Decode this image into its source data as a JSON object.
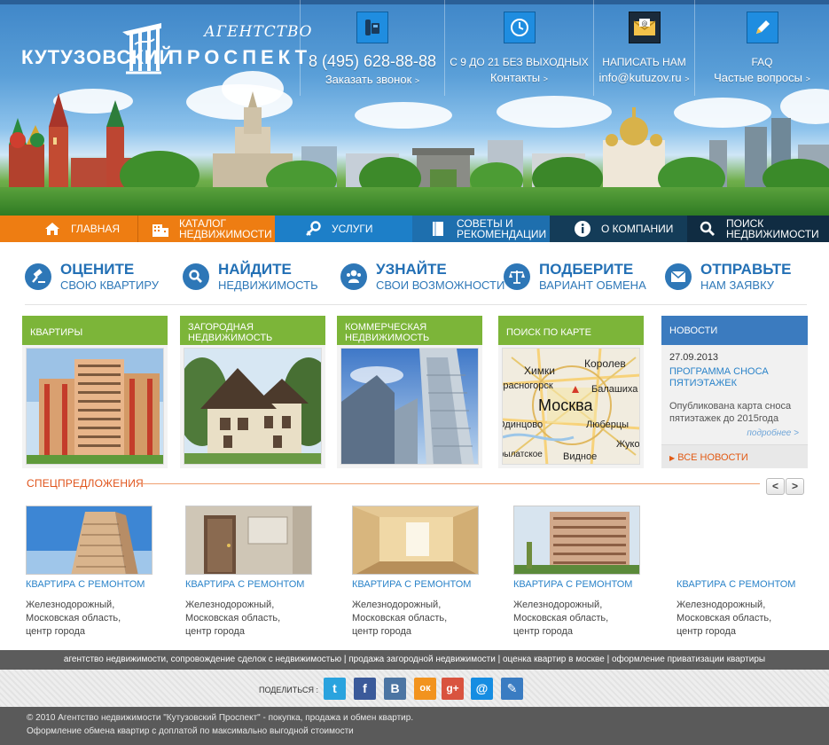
{
  "header": {
    "agency_label": "АГЕНТСТВО",
    "name_part1": "КУТУЗОВСКИЙ",
    "name_part2": "ПРОСПЕКТ",
    "contacts": [
      {
        "icon": "phone-icon",
        "line1": "8 (495) 628-88-88",
        "line2": "Заказать звонок",
        "arrow": ">"
      },
      {
        "icon": "clock-icon",
        "line1": "С 9 ДО 21 БЕЗ ВЫХОДНЫХ",
        "line2": "Контакты",
        "arrow": ">"
      },
      {
        "icon": "mail-icon",
        "line1": "НАПИСАТЬ НАМ",
        "line2": "info@kutuzov.ru",
        "arrow": ">"
      },
      {
        "icon": "pencil-icon",
        "line1": "FAQ",
        "line2": "Частые вопросы",
        "arrow": ">"
      }
    ]
  },
  "nav": [
    {
      "icon": "home-icon",
      "label": "ГЛАВНАЯ"
    },
    {
      "icon": "building-icon",
      "label": "КАТАЛОГ НЕДВИЖИМОСТИ"
    },
    {
      "icon": "key-icon",
      "label": "УСЛУГИ"
    },
    {
      "icon": "book-icon",
      "label": "СОВЕТЫ И РЕКОМЕНДАЦИИ"
    },
    {
      "icon": "info-icon",
      "label": "О КОМПАНИИ"
    },
    {
      "icon": "search-icon",
      "label": "ПОИСК НЕДВИЖИМОСТИ"
    }
  ],
  "actions": [
    {
      "icon": "gavel-icon",
      "title": "ОЦЕНИТЕ",
      "subtitle": "СВОЮ КВАРТИРУ"
    },
    {
      "icon": "search-icon",
      "title": "НАЙДИТЕ",
      "subtitle": "НЕДВИЖИМОСТЬ"
    },
    {
      "icon": "people-icon",
      "title": "УЗНАЙТЕ",
      "subtitle": "СВОИ ВОЗМОЖНОСТИ"
    },
    {
      "icon": "scales-icon",
      "title": "ПОДБЕРИТЕ",
      "subtitle": "ВАРИАНТ ОБМЕНА"
    },
    {
      "icon": "envelope-icon",
      "title": "ОТПРАВЬТЕ",
      "subtitle": "НАМ ЗАЯВКУ"
    }
  ],
  "categories": [
    {
      "label": "КВАРТИРЫ"
    },
    {
      "label": "ЗАГОРОДНАЯ НЕДВИЖИМОСТЬ"
    },
    {
      "label": "КОММЕРЧЕСКАЯ НЕДВИЖИМОСТЬ"
    },
    {
      "label": "ПОИСК ПО КАРТЕ"
    }
  ],
  "map_labels": {
    "city": "Москва",
    "places": [
      "Химки",
      "Королев",
      "Красногорск",
      "Балашиха",
      "Одинцово",
      "Люберцы",
      "Видное",
      "Жуковский",
      "Крылатское"
    ]
  },
  "news": {
    "header": "НОВОСТИ",
    "date": "27.09.2013",
    "title": "ПРОГРАММА СНОСА ПЯТИЭТАЖЕК",
    "text": "Опубликована карта сноса пятиэтажек до 2015года",
    "more": "подробнее >",
    "all": "ВСЕ НОВОСТИ"
  },
  "specials": {
    "title": "СПЕЦПРЕДЛОЖЕНИЯ",
    "prev": "<",
    "next": ">",
    "items": [
      {
        "title": "КВАРТИРА С РЕМОНТОМ",
        "line1": "Железнодорожный,",
        "line2": "Московская область,",
        "line3": "центр города"
      },
      {
        "title": "КВАРТИРА С РЕМОНТОМ",
        "line1": "Железнодорожный,",
        "line2": "Московская область,",
        "line3": "центр города"
      },
      {
        "title": "КВАРТИРА С РЕМОНТОМ",
        "line1": "Железнодорожный,",
        "line2": "Московская область,",
        "line3": "центр города"
      },
      {
        "title": "КВАРТИРА С РЕМОНТОМ",
        "line1": "Железнодорожный,",
        "line2": "Московская область,",
        "line3": "центр города"
      },
      {
        "title": "КВАРТИРА С РЕМОНТОМ",
        "line1": "Железнодорожный,",
        "line2": "Московская область,",
        "line3": "центр города"
      }
    ]
  },
  "footer": {
    "links": "агентство недвижимости, сопровождение сделок с недвижимостью | продажа загородной недвижимости | оценка квартир в москве | оформление приватизации квартиры",
    "share_label": "ПОДЕЛИТЬСЯ :",
    "social": [
      {
        "icon": "twitter-icon",
        "glyph": "t",
        "color": "#2aa3de"
      },
      {
        "icon": "facebook-icon",
        "glyph": "f",
        "color": "#3b5a9a"
      },
      {
        "icon": "vkontakte-icon",
        "glyph": "В",
        "color": "#4c75a3"
      },
      {
        "icon": "odnoklassniki-icon",
        "glyph": "ок",
        "color": "#f2931e"
      },
      {
        "icon": "google-plus-icon",
        "glyph": "g+",
        "color": "#d9533f"
      },
      {
        "icon": "mailru-icon",
        "glyph": "@",
        "color": "#168de2"
      },
      {
        "icon": "livejournal-icon",
        "glyph": "✎",
        "color": "#3a7cc2"
      }
    ],
    "copyright": "© 2010 Агентство недвижимости \"Кутузовский Проспект\" - покупка, продажа и обмен квартир.",
    "tagline": "Оформление обмена квартир с доплатой по максимально выгодной стоимости"
  },
  "colors": {
    "orange": "#ee7d12",
    "blue": "#1d7fc8",
    "dark_navy": "#143c58",
    "green": "#7cb539",
    "link_blue": "#2a83c9",
    "special_orange": "#e0531a"
  }
}
